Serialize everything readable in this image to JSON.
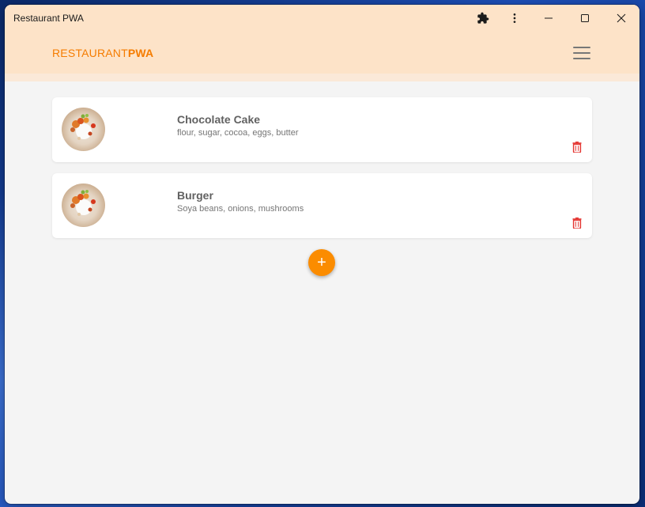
{
  "window": {
    "title": "Restaurant PWA"
  },
  "navbar": {
    "brand_light": "RESTAURANT",
    "brand_bold": "PWA"
  },
  "recipes": [
    {
      "title": "Chocolate Cake",
      "ingredients": "flour, sugar, cocoa, eggs, butter"
    },
    {
      "title": "Burger",
      "ingredients": "Soya beans, onions, mushrooms"
    }
  ],
  "fab": {
    "label": "+"
  },
  "colors": {
    "accent": "#fb8c00",
    "navbar_bg": "#fde3c8",
    "delete_icon": "#e53935"
  },
  "icons": [
    "extension-icon",
    "more-vert-icon",
    "minimize-icon",
    "maximize-icon",
    "close-icon",
    "hamburger-menu-icon",
    "delete-icon"
  ]
}
